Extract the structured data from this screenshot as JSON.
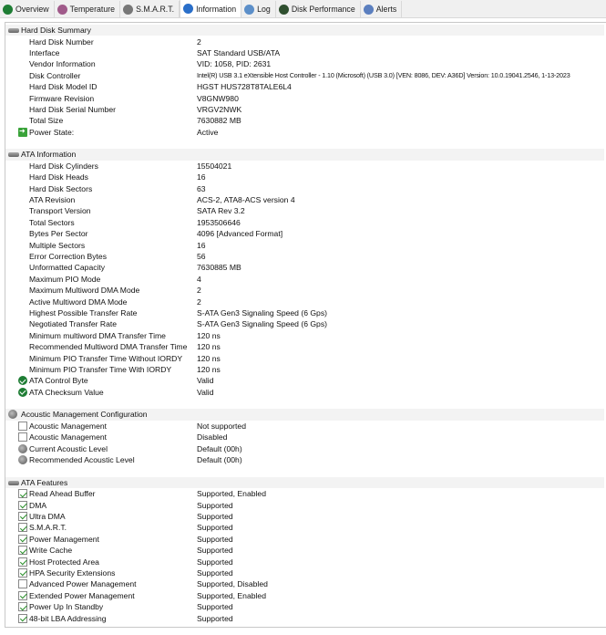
{
  "tabs": [
    {
      "label": "Overview",
      "icon": "check-circle-icon",
      "color": "#1e7d34"
    },
    {
      "label": "Temperature",
      "icon": "thermometer-icon",
      "color": "#a05a8a"
    },
    {
      "label": "S.M.A.R.T.",
      "icon": "disk-icon",
      "color": "#777777"
    },
    {
      "label": "Information",
      "icon": "info-icon",
      "color": "#2a6fc9",
      "active": true
    },
    {
      "label": "Log",
      "icon": "log-icon",
      "color": "#5c8fc9"
    },
    {
      "label": "Disk Performance",
      "icon": "performance-icon",
      "color": "#2f4f2f"
    },
    {
      "label": "Alerts",
      "icon": "alerts-icon",
      "color": "#5b7fbf"
    }
  ],
  "sections": [
    {
      "title": "Hard Disk Summary",
      "icon": "disk",
      "rows": [
        {
          "label": "Hard Disk Number",
          "value": "2"
        },
        {
          "label": "Interface",
          "value": "SAT Standard USB/ATA"
        },
        {
          "label": "Vendor Information",
          "value": "VID: 1058, PID: 2631"
        },
        {
          "label": "Disk Controller",
          "value": "Intel(R) USB 3.1 eXtensible Host Controller - 1.10 (Microsoft) (USB 3.0) [VEN: 8086, DEV: A36D] Version: 10.0.19041.2546, 1-13-2023"
        },
        {
          "label": "Hard Disk Model ID",
          "value": "HGST HUS728T8TALE6L4"
        },
        {
          "label": "Firmware Revision",
          "value": "V8GNW980"
        },
        {
          "label": "Hard Disk Serial Number",
          "value": "VRGV2NWK"
        },
        {
          "label": "Total Size",
          "value": "7630882 MB"
        },
        {
          "label": "Power State:",
          "value": "Active",
          "icon": "arrow"
        }
      ]
    },
    {
      "title": "ATA Information",
      "icon": "disk",
      "rows": [
        {
          "label": "Hard Disk Cylinders",
          "value": "15504021"
        },
        {
          "label": "Hard Disk Heads",
          "value": "16"
        },
        {
          "label": "Hard Disk Sectors",
          "value": "63"
        },
        {
          "label": "ATA Revision",
          "value": "ACS-2, ATA8-ACS version 4"
        },
        {
          "label": "Transport Version",
          "value": "SATA Rev 3.2"
        },
        {
          "label": "Total Sectors",
          "value": "1953506646"
        },
        {
          "label": "Bytes Per Sector",
          "value": "4096 [Advanced Format]"
        },
        {
          "label": "Multiple Sectors",
          "value": "16"
        },
        {
          "label": "Error Correction Bytes",
          "value": "56"
        },
        {
          "label": "Unformatted Capacity",
          "value": "7630885 MB"
        },
        {
          "label": "Maximum PIO Mode",
          "value": "4"
        },
        {
          "label": "Maximum Multiword DMA Mode",
          "value": "2"
        },
        {
          "label": "Active Multiword DMA Mode",
          "value": "2"
        },
        {
          "label": "Highest Possible Transfer Rate",
          "value": "S-ATA Gen3 Signaling Speed (6 Gps)"
        },
        {
          "label": "Negotiated Transfer Rate",
          "value": "S-ATA Gen3 Signaling Speed (6 Gps)"
        },
        {
          "label": "Minimum multiword DMA Transfer Time",
          "value": "120 ns"
        },
        {
          "label": "Recommended Multiword DMA Transfer Time",
          "value": "120 ns"
        },
        {
          "label": "Minimum PIO Transfer Time Without IORDY",
          "value": "120 ns"
        },
        {
          "label": "Minimum PIO Transfer Time With IORDY",
          "value": "120 ns"
        },
        {
          "label": "ATA Control Byte",
          "value": "Valid",
          "icon": "ok"
        },
        {
          "label": "ATA Checksum Value",
          "value": "Valid",
          "icon": "ok"
        }
      ]
    },
    {
      "title": "Acoustic Management Configuration",
      "icon": "spk",
      "rows": [
        {
          "label": "Acoustic Management",
          "value": "Not supported",
          "icon": "chk"
        },
        {
          "label": "Acoustic Management",
          "value": "Disabled",
          "icon": "chk"
        },
        {
          "label": "Current Acoustic Level",
          "value": "Default (00h)",
          "icon": "spk"
        },
        {
          "label": "Recommended Acoustic Level",
          "value": "Default (00h)",
          "icon": "spk"
        }
      ]
    },
    {
      "title": "ATA Features",
      "icon": "disk",
      "rows": [
        {
          "label": "Read Ahead Buffer",
          "value": "Supported, Enabled",
          "icon": "chk on"
        },
        {
          "label": "DMA",
          "value": "Supported",
          "icon": "chk on"
        },
        {
          "label": "Ultra DMA",
          "value": "Supported",
          "icon": "chk on"
        },
        {
          "label": "S.M.A.R.T.",
          "value": "Supported",
          "icon": "chk on"
        },
        {
          "label": "Power Management",
          "value": "Supported",
          "icon": "chk on"
        },
        {
          "label": "Write Cache",
          "value": "Supported",
          "icon": "chk on"
        },
        {
          "label": "Host Protected Area",
          "value": "Supported",
          "icon": "chk on"
        },
        {
          "label": "HPA Security Extensions",
          "value": "Supported",
          "icon": "chk on"
        },
        {
          "label": "Advanced Power Management",
          "value": "Supported, Disabled",
          "icon": "chk"
        },
        {
          "label": "Extended Power Management",
          "value": "Supported, Enabled",
          "icon": "chk on"
        },
        {
          "label": "Power Up In Standby",
          "value": "Supported",
          "icon": "chk on"
        },
        {
          "label": "48-bit LBA Addressing",
          "value": "Supported",
          "icon": "chk on"
        }
      ]
    }
  ]
}
